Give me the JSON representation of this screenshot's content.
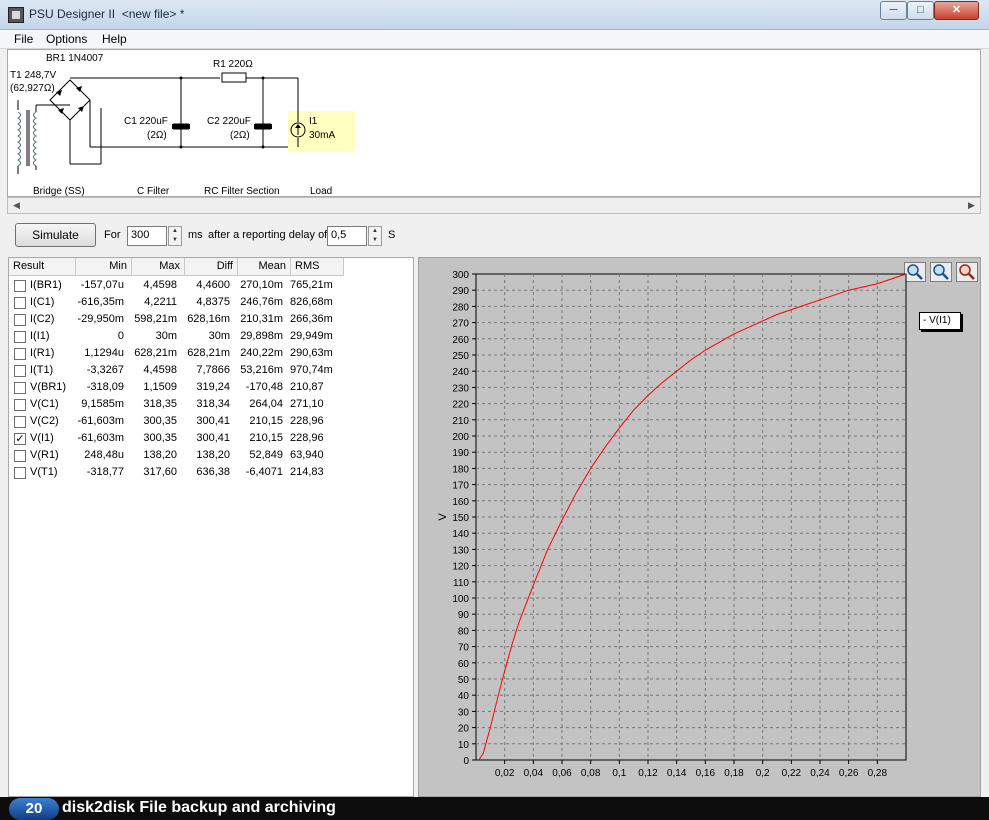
{
  "window": {
    "title": "PSU Designer II  <new file> *"
  },
  "menu": [
    "File",
    "Options",
    "Help"
  ],
  "schematic": {
    "br1_label": "BR1 1N4007",
    "t1_label": "T1 248,7V",
    "t1_res": "(62,927Ω)",
    "r1_label": "R1 220Ω",
    "c1_label": "C1 220uF",
    "c1_res": "(2Ω)",
    "c2_label": "C2 220uF",
    "c2_res": "(2Ω)",
    "load_name": "I1",
    "load_value": "30mA",
    "sections": [
      "Bridge (SS)",
      "C Filter",
      "RC Filter Section",
      "Load"
    ]
  },
  "controls": {
    "simulate_label": "Simulate",
    "for_label": "For",
    "duration": "300",
    "ms_label": "ms",
    "delay_label": "after a reporting delay of",
    "delay": "0,5",
    "s_label": "S"
  },
  "results": {
    "columns": [
      "Result",
      "Min",
      "Max",
      "Diff",
      "Mean",
      "RMS"
    ],
    "rows": [
      {
        "name": "I(BR1)",
        "checked": false,
        "min": "-157,07u",
        "max": "4,4598",
        "diff": "4,4600",
        "mean": "270,10m",
        "rms": "765,21m"
      },
      {
        "name": "I(C1)",
        "checked": false,
        "min": "-616,35m",
        "max": "4,2211",
        "diff": "4,8375",
        "mean": "246,76m",
        "rms": "826,68m"
      },
      {
        "name": "I(C2)",
        "checked": false,
        "min": "-29,950m",
        "max": "598,21m",
        "diff": "628,16m",
        "mean": "210,31m",
        "rms": "266,36m"
      },
      {
        "name": "I(I1)",
        "checked": false,
        "min": "0",
        "max": "30m",
        "diff": "30m",
        "mean": "29,898m",
        "rms": "29,949m"
      },
      {
        "name": "I(R1)",
        "checked": false,
        "min": "1,1294u",
        "max": "628,21m",
        "diff": "628,21m",
        "mean": "240,22m",
        "rms": "290,63m"
      },
      {
        "name": "I(T1)",
        "checked": false,
        "min": "-3,3267",
        "max": "4,4598",
        "diff": "7,7866",
        "mean": "53,216m",
        "rms": "970,74m"
      },
      {
        "name": "V(BR1)",
        "checked": false,
        "min": "-318,09",
        "max": "1,1509",
        "diff": "319,24",
        "mean": "-170,48",
        "rms": "210,87"
      },
      {
        "name": "V(C1)",
        "checked": false,
        "min": "9,1585m",
        "max": "318,35",
        "diff": "318,34",
        "mean": "264,04",
        "rms": "271,10"
      },
      {
        "name": "V(C2)",
        "checked": false,
        "min": "-61,603m",
        "max": "300,35",
        "diff": "300,41",
        "mean": "210,15",
        "rms": "228,96"
      },
      {
        "name": "V(I1)",
        "checked": true,
        "min": "-61,603m",
        "max": "300,35",
        "diff": "300,41",
        "mean": "210,15",
        "rms": "228,96"
      },
      {
        "name": "V(R1)",
        "checked": false,
        "min": "248,48u",
        "max": "138,20",
        "diff": "138,20",
        "mean": "52,849",
        "rms": "63,940"
      },
      {
        "name": "V(T1)",
        "checked": false,
        "min": "-318,77",
        "max": "317,60",
        "diff": "636,38",
        "mean": "-6,4071",
        "rms": "214,83"
      }
    ]
  },
  "chart_data": {
    "type": "line",
    "ylabel": "V",
    "xlabel": "",
    "xlim": [
      0,
      0.3
    ],
    "ylim": [
      0,
      300
    ],
    "grid": true,
    "legend": "top-right",
    "x_ticks": [
      "0,02",
      "0,04",
      "0,06",
      "0,08",
      "0,1",
      "0,12",
      "0,14",
      "0,16",
      "0,18",
      "0,2",
      "0,22",
      "0,24",
      "0,26",
      "0,28"
    ],
    "y_ticks": [
      "0",
      "10",
      "20",
      "30",
      "40",
      "50",
      "60",
      "70",
      "80",
      "90",
      "100",
      "110",
      "120",
      "130",
      "140",
      "150",
      "160",
      "170",
      "180",
      "190",
      "200",
      "210",
      "220",
      "230",
      "240",
      "250",
      "260",
      "270",
      "280",
      "290",
      "300"
    ],
    "series": [
      {
        "name": "V(I1)",
        "color": "#ff0000",
        "x": [
          0.002,
          0.005,
          0.01,
          0.015,
          0.02,
          0.025,
          0.03,
          0.04,
          0.05,
          0.06,
          0.07,
          0.08,
          0.09,
          0.1,
          0.11,
          0.12,
          0.13,
          0.14,
          0.15,
          0.16,
          0.17,
          0.18,
          0.19,
          0.2,
          0.21,
          0.22,
          0.23,
          0.24,
          0.25,
          0.26,
          0.27,
          0.28,
          0.29,
          0.3
        ],
        "y": [
          0,
          4,
          20,
          38,
          55,
          71,
          85,
          108,
          130,
          148,
          165,
          180,
          193,
          205,
          216,
          225,
          233,
          240,
          247,
          253,
          258,
          263,
          267,
          271,
          275,
          278,
          281,
          284,
          287,
          290,
          292,
          294,
          297,
          300
        ]
      }
    ]
  },
  "banner": {
    "badge": "20",
    "text": "disk2disk File backup and archiving"
  }
}
